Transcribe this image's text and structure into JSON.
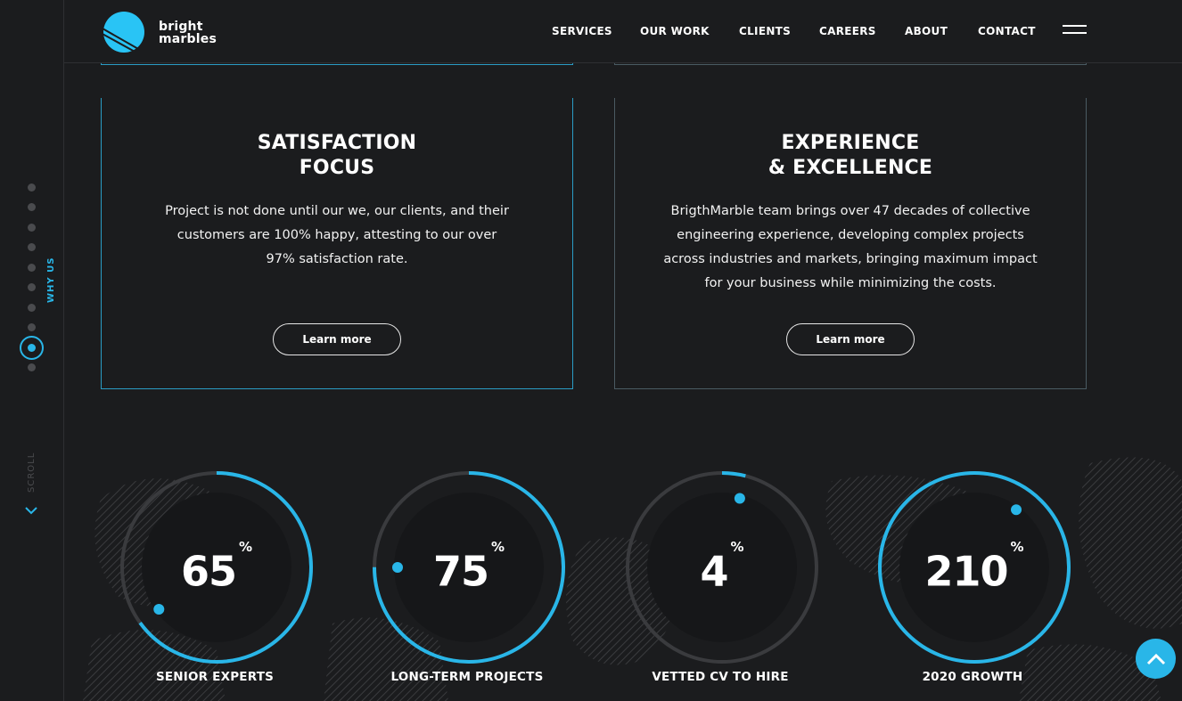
{
  "brand": {
    "line1": "bright",
    "line2": "marbles",
    "accent_color": "#29b6e8"
  },
  "nav": {
    "items": [
      {
        "label": "SERVICES"
      },
      {
        "label": "OUR WORK"
      },
      {
        "label": "CLIENTS"
      },
      {
        "label": "CAREERS"
      },
      {
        "label": "ABOUT"
      },
      {
        "label": "CONTACT"
      }
    ],
    "menu_icon": "hamburger-icon"
  },
  "rail": {
    "section_label": "WHY US",
    "scroll_label": "SCROLL",
    "total_sections": 10,
    "active_section": 9
  },
  "cards": [
    {
      "title_line1": "SATISFACTION",
      "title_line2": "FOCUS",
      "body": "Project is not done until our we, our clients, and their customers are 100% happy, attesting to our over 97% satisfaction rate.",
      "button": "Learn more"
    },
    {
      "title_line1": "EXPERIENCE",
      "title_line2": "& EXCELLENCE",
      "body": "BrigthMarble team brings over 47 decades of collective engineering experience, developing complex projects across industries and markets, bringing maximum impact for your business while minimizing the costs.",
      "button": "Learn more"
    }
  ],
  "stats": [
    {
      "value": "65",
      "unit": "%",
      "label": "SENIOR EXPERTS",
      "progress": 0.65
    },
    {
      "value": "75",
      "unit": "%",
      "label": "LONG-TERM PROJECTS",
      "progress": 0.75
    },
    {
      "value": "4",
      "unit": "%",
      "label": "VETTED CV TO HIRE",
      "progress": 0.04
    },
    {
      "value": "210",
      "unit": "%",
      "label": "2020 GROWTH",
      "progress": 1.0
    }
  ],
  "back_to_top_icon": "chevron-up-icon"
}
